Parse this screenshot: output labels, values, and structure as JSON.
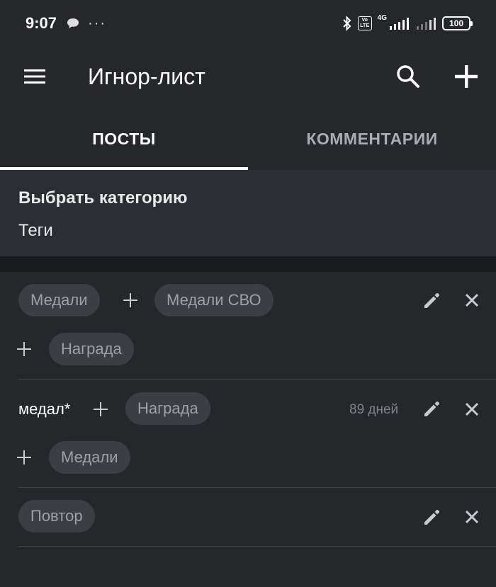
{
  "status_bar": {
    "time": "9:07",
    "dots": "···",
    "volte_top": "Vo",
    "volte_bottom": "LTE",
    "network": "4G",
    "battery": "100"
  },
  "app_bar": {
    "title": "Игнор-лист"
  },
  "tabs": [
    {
      "label": "ПОСТЫ",
      "active": true
    },
    {
      "label": "КОММЕНТАРИИ",
      "active": false
    }
  ],
  "category": {
    "heading": "Выбрать категорию",
    "value": "Теги"
  },
  "rules": [
    {
      "chips_line1": [
        "Медали",
        "Медали СВО"
      ],
      "chips_line2": [
        "Награда"
      ]
    },
    {
      "word": "медал*",
      "chips_line1": [
        "Награда"
      ],
      "days": "89 дней",
      "chips_line2": [
        "Медали"
      ]
    },
    {
      "chips_line1": [
        "Повтор"
      ]
    }
  ],
  "colors": {
    "background": "#25272b",
    "panel": "#2b2d32",
    "chip": "#3b3e43",
    "chip_text": "#9da1a7",
    "accent": "#ffffff"
  }
}
